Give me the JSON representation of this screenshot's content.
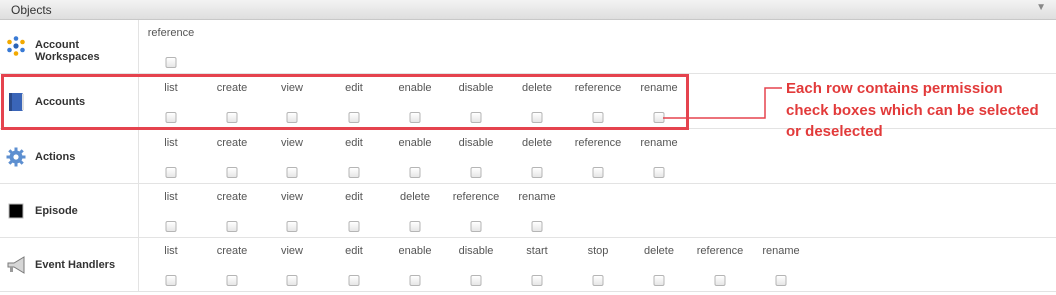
{
  "header": {
    "title": "Objects",
    "collapse_icon": "chevron-down-icon"
  },
  "rows": [
    {
      "name": "Account Workspaces",
      "icon": "dots-cluster-icon",
      "permissions": [
        "reference"
      ]
    },
    {
      "name": "Accounts",
      "icon": "book-icon",
      "permissions": [
        "list",
        "create",
        "view",
        "edit",
        "enable",
        "disable",
        "delete",
        "reference",
        "rename"
      ]
    },
    {
      "name": "Actions",
      "icon": "gear-icon",
      "permissions": [
        "list",
        "create",
        "view",
        "edit",
        "enable",
        "disable",
        "delete",
        "reference",
        "rename"
      ]
    },
    {
      "name": "Episode",
      "icon": "black-square-icon",
      "permissions": [
        "list",
        "create",
        "view",
        "edit",
        "delete",
        "reference",
        "rename"
      ]
    },
    {
      "name": "Event Handlers",
      "icon": "megaphone-icon",
      "permissions": [
        "list",
        "create",
        "view",
        "edit",
        "enable",
        "disable",
        "start",
        "stop",
        "delete",
        "reference",
        "rename"
      ]
    }
  ],
  "annotation": {
    "text": "Each row contains permission check boxes which can be selected or deselected",
    "color": "#e23a3a"
  }
}
